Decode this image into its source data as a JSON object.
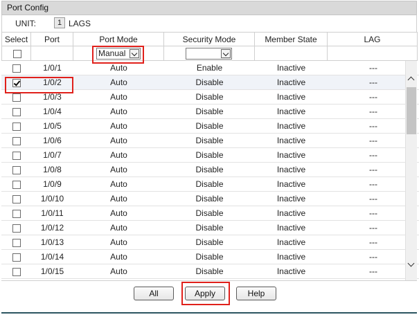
{
  "panel": {
    "title": "Port Config"
  },
  "unit": {
    "label": "UNIT:",
    "value": "1",
    "lags": "LAGS"
  },
  "columns": [
    "Select",
    "Port",
    "Port Mode",
    "Security Mode",
    "Member State",
    "LAG"
  ],
  "controls": {
    "port_mode": "Manual",
    "security_mode": ""
  },
  "rows": [
    {
      "port": "1/0/1",
      "mode": "Auto",
      "security": "Enable",
      "state": "Inactive",
      "lag": "---",
      "checked": false
    },
    {
      "port": "1/0/2",
      "mode": "Auto",
      "security": "Disable",
      "state": "Inactive",
      "lag": "---",
      "checked": true
    },
    {
      "port": "1/0/3",
      "mode": "Auto",
      "security": "Disable",
      "state": "Inactive",
      "lag": "---",
      "checked": false
    },
    {
      "port": "1/0/4",
      "mode": "Auto",
      "security": "Disable",
      "state": "Inactive",
      "lag": "---",
      "checked": false
    },
    {
      "port": "1/0/5",
      "mode": "Auto",
      "security": "Disable",
      "state": "Inactive",
      "lag": "---",
      "checked": false
    },
    {
      "port": "1/0/6",
      "mode": "Auto",
      "security": "Disable",
      "state": "Inactive",
      "lag": "---",
      "checked": false
    },
    {
      "port": "1/0/7",
      "mode": "Auto",
      "security": "Disable",
      "state": "Inactive",
      "lag": "---",
      "checked": false
    },
    {
      "port": "1/0/8",
      "mode": "Auto",
      "security": "Disable",
      "state": "Inactive",
      "lag": "---",
      "checked": false
    },
    {
      "port": "1/0/9",
      "mode": "Auto",
      "security": "Disable",
      "state": "Inactive",
      "lag": "---",
      "checked": false
    },
    {
      "port": "1/0/10",
      "mode": "Auto",
      "security": "Disable",
      "state": "Inactive",
      "lag": "---",
      "checked": false
    },
    {
      "port": "1/0/11",
      "mode": "Auto",
      "security": "Disable",
      "state": "Inactive",
      "lag": "---",
      "checked": false
    },
    {
      "port": "1/0/12",
      "mode": "Auto",
      "security": "Disable",
      "state": "Inactive",
      "lag": "---",
      "checked": false
    },
    {
      "port": "1/0/13",
      "mode": "Auto",
      "security": "Disable",
      "state": "Inactive",
      "lag": "---",
      "checked": false
    },
    {
      "port": "1/0/14",
      "mode": "Auto",
      "security": "Disable",
      "state": "Inactive",
      "lag": "---",
      "checked": false
    },
    {
      "port": "1/0/15",
      "mode": "Auto",
      "security": "Disable",
      "state": "Inactive",
      "lag": "---",
      "checked": false
    }
  ],
  "buttons": {
    "all": "All",
    "apply": "Apply",
    "help": "Help"
  }
}
